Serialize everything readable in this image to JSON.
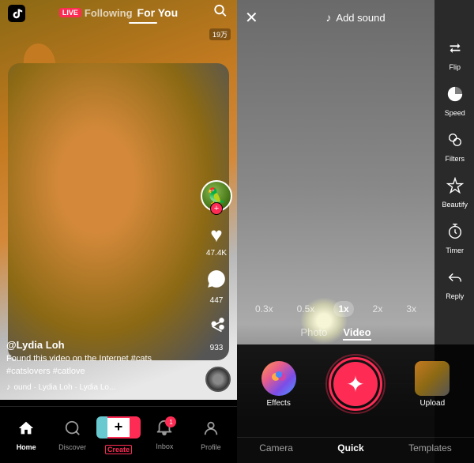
{
  "app": {
    "title": "TikTok"
  },
  "left": {
    "nav": {
      "live_badge": "LIVE",
      "following": "Following",
      "for_you": "For You"
    },
    "video": {
      "view_count": "19万",
      "likes": "47.4K",
      "comments": "447",
      "shares": "933"
    },
    "user": {
      "username": "@Lydia Loh",
      "caption": "Found this video on the Internet #cats #catslovers #catlove",
      "music": "♪ ound · Lydia Loh · Lydia Lo..."
    },
    "bottom_nav": {
      "home": "Home",
      "discover": "Discover",
      "create": "Create",
      "inbox": "Inbox",
      "profile": "Profile",
      "inbox_count": "1"
    }
  },
  "right": {
    "header": {
      "close": "✕",
      "add_sound": "Add sound"
    },
    "tools": {
      "flip": "Flip",
      "speed": "Speed",
      "filters": "Filters",
      "beautify": "Beautify",
      "timer": "Timer",
      "reply": "Reply"
    },
    "speed_options": [
      "0.3x",
      "0.5x",
      "1x",
      "2x",
      "3x"
    ],
    "active_speed": "1x",
    "tabs": {
      "photo": "Photo",
      "video": "Video"
    },
    "active_tab": "Video",
    "bottom": {
      "effects": "Effects",
      "upload": "Upload",
      "camera_tab": "Camera",
      "quick_tab": "Quick",
      "templates_tab": "Templates"
    }
  }
}
